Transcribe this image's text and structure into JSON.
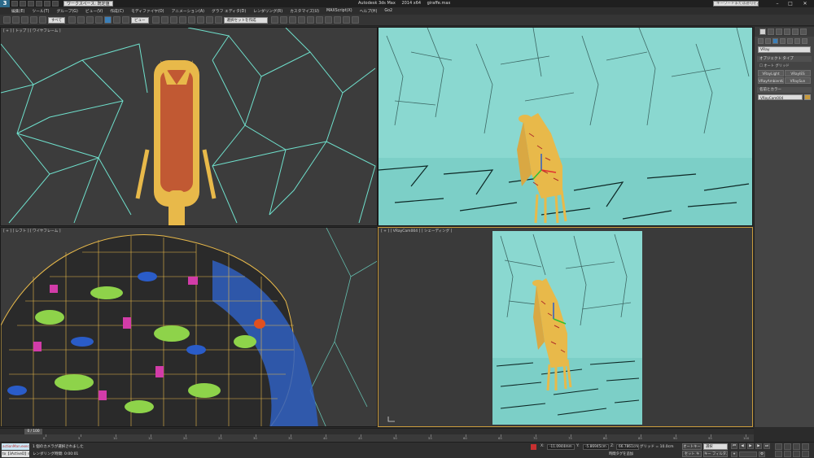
{
  "titlebar": {
    "logo": "3",
    "workspace": "ワークスペース: 既定値",
    "app_name": "Autodesk 3ds Max",
    "app_version": "2014 x64",
    "file_name": "giraffe.max",
    "search_placeholder": "キーワードまたは語句を入力",
    "minimize": "–",
    "maximize": "□",
    "close": "✕"
  },
  "menubar": {
    "items": [
      "編集(E)",
      "ツール(T)",
      "グループ(G)",
      "ビュー(V)",
      "作成(C)",
      "モディファイヤ(O)",
      "アニメーション(A)",
      "グラフ エディタ(D)",
      "レンダリング(R)",
      "カスタマイズ(U)",
      "MAXScript(X)",
      "ヘルプ(H)",
      "Go2"
    ]
  },
  "toolbar": {
    "filter_dropdown": "すべて",
    "coord_dropdown": "ビュー",
    "selection_set": "選択セットを作成"
  },
  "viewports": {
    "top_label": "[ + ] [ トップ ] [ ワイヤフレーム ]",
    "persp_label": "",
    "left_label": "[ + ] [ レフト ] [ ワイヤフレーム ]",
    "camera_label": "[ + ] [ VRayCam004 ] [ シェーディング ]"
  },
  "command_panel": {
    "category": "VRay",
    "object_type_header": "オブジェクト タイプ",
    "autogrid_label": "オート グリッド",
    "buttons": [
      "VRayLight",
      "VRayIES",
      "VRayAmbientLight",
      "VRaySun"
    ],
    "name_color_header": "名前とカラー",
    "object_name": "VRayCam004",
    "swatch_color": "#c89a3c"
  },
  "timeline": {
    "frame_label": "0 / 100",
    "ticks": [
      "0",
      "5",
      "10",
      "15",
      "20",
      "25",
      "30",
      "35",
      "40",
      "45",
      "50",
      "55",
      "60",
      "65",
      "70",
      "75",
      "80",
      "85",
      "90",
      "95",
      "100"
    ]
  },
  "statusbar": {
    "maxscript": "actionMan.execut",
    "active": "to【3ActiveD】ss",
    "prompt": "1 個のカメラが選択されました",
    "render_time": "レンダリング時間: 0:00:01",
    "x_label": "X:",
    "x_value": "-11.0944mm",
    "y_label": "Y:",
    "y_value": "-5.86945cm",
    "z_label": "Z:",
    "z_value": "66.7861cm",
    "grid": "グリッド = 10.0cm",
    "add_time_tag": "時間タグを追加",
    "auto_key": "オートキー",
    "set_key": "セット キー",
    "selection": "選択",
    "key_filter": "キー フィルタ..."
  },
  "colors": {
    "accent": "#3b7fb8",
    "viewport_sky": "#8ad8d0",
    "wire": "#6fe0cc",
    "giraffe": "#e8b94a",
    "camera_border": "#c89a3c"
  }
}
